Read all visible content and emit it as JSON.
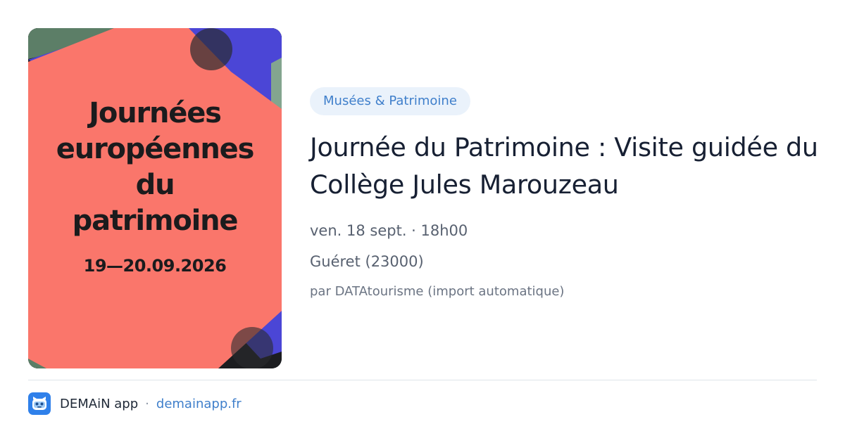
{
  "poster": {
    "title_lines": [
      "Journées",
      "européennes",
      "du",
      "patrimoine"
    ],
    "dates": "19—20.09.2026",
    "colors": {
      "background": "#1c1d20",
      "salmon": "#fa766b",
      "green": "#5c7e67",
      "blue": "#4b46d6",
      "sage": "#83a58f"
    }
  },
  "event": {
    "category": "Musées & Patrimoine",
    "title": "Journée du Patrimoine : Visite guidée du Collège Jules Marouzeau",
    "datetime": "ven. 18 sept. · 18h00",
    "location": "Guéret (23000)",
    "source": "par DATAtourisme (import automatique)"
  },
  "footer": {
    "app_name": "DEMAiN app",
    "separator": "·",
    "domain": "demainapp.fr",
    "logo_icon": "robot-face-icon"
  },
  "colors": {
    "accent": "#3f7fcb",
    "badge_bg": "#eaf2fb",
    "text_primary": "#172033",
    "text_secondary": "#586170"
  }
}
